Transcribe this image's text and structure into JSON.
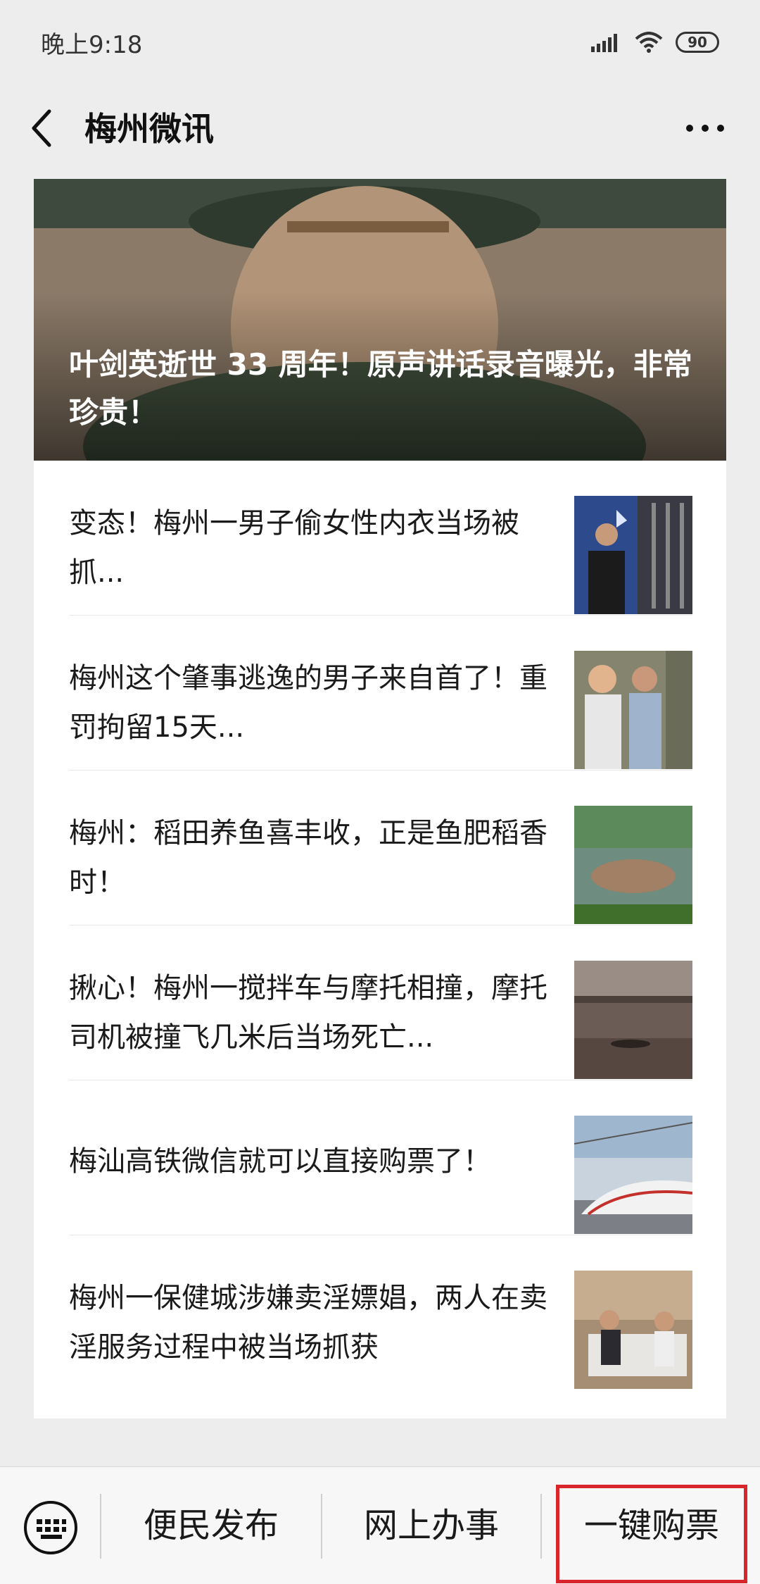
{
  "status_bar": {
    "time": "晚上9:18",
    "battery": "90"
  },
  "nav": {
    "title": "梅州微讯"
  },
  "hero": {
    "title": "叶剑英逝世 33 周年！原声讲话录音曝光，非常珍贵！"
  },
  "articles": [
    {
      "title": "变态！梅州一男子偷女性内衣当场被抓..."
    },
    {
      "title": "梅州这个肇事逃逸的男子来自首了！重罚拘留15天..."
    },
    {
      "title": "梅州：稻田养鱼喜丰收，正是鱼肥稻香时！"
    },
    {
      "title": "揪心！梅州一搅拌车与摩托相撞，摩托司机被撞飞几米后当场死亡..."
    },
    {
      "title": "梅汕高铁微信就可以直接购票了！"
    },
    {
      "title": "梅州一保健城涉嫌卖淫嫖娼，两人在卖淫服务过程中被当场抓获"
    }
  ],
  "bottom_menu": {
    "items": [
      {
        "label": "便民发布"
      },
      {
        "label": "网上办事"
      },
      {
        "label": "一键购票"
      }
    ]
  },
  "colors": {
    "highlight": "#d9262c",
    "background": "#ededed"
  }
}
